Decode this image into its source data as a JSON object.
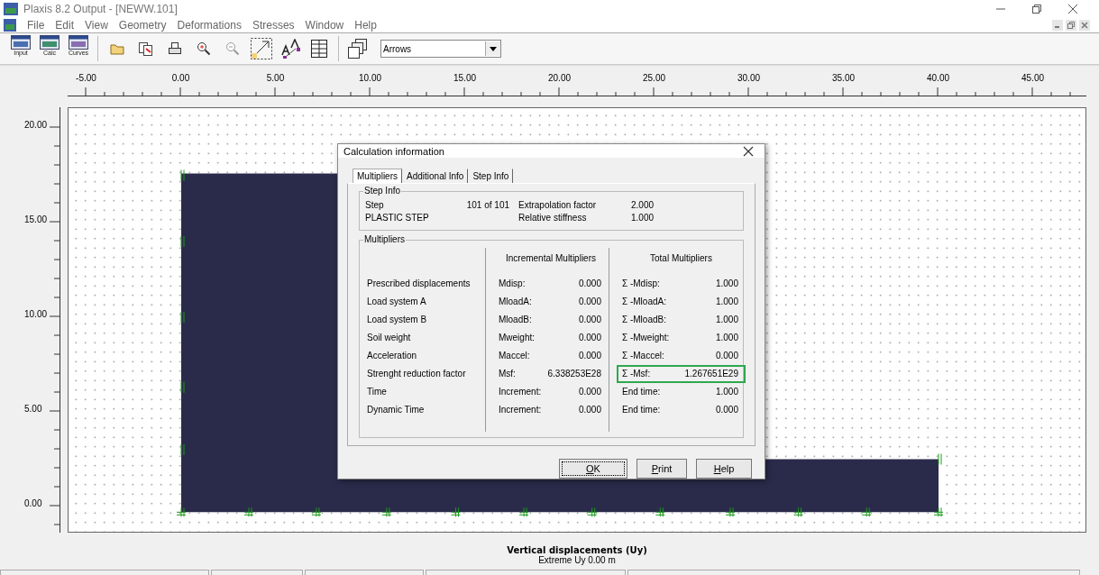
{
  "window": {
    "title": "Plaxis 8.2 Output - [NEWW.101]"
  },
  "menu": [
    "File",
    "Edit",
    "View",
    "Geometry",
    "Deformations",
    "Stresses",
    "Window",
    "Help"
  ],
  "toolbar": {
    "program_buttons": [
      {
        "label": "Input"
      },
      {
        "label": "Calc"
      },
      {
        "label": "Curves"
      }
    ],
    "dropdown": {
      "value": "Arrows"
    }
  },
  "plot": {
    "x_ticks": [
      "-5.00",
      "0.00",
      "5.00",
      "10.00",
      "15.00",
      "20.00",
      "25.00",
      "30.00",
      "35.00",
      "40.00",
      "45.00"
    ],
    "y_ticks": [
      "20.00",
      "15.00",
      "10.00",
      "5.00",
      "0.00"
    ],
    "title": "Vertical displacements (Uy)",
    "subtitle": "Extreme Uy 0.00 m"
  },
  "dialog": {
    "title": "Calculation information",
    "tabs": [
      {
        "label": "Multipliers",
        "selected": true
      },
      {
        "label": "Additional Info",
        "selected": false
      },
      {
        "label": "Step Info",
        "selected": false
      }
    ],
    "step_info": {
      "title": "Step Info",
      "rows": [
        {
          "label": "Step",
          "value": "101 of 101",
          "param": "Extrapolation factor",
          "param_value": "2.000"
        },
        {
          "label": "PLASTIC STEP",
          "param": "Relative stiffness",
          "param_value": "1.000"
        }
      ]
    },
    "multipliers": {
      "title": "Multipliers",
      "incremental_header": "Incremental Multipliers",
      "total_header": "Total Multipliers",
      "rows": [
        {
          "label": "Prescribed displacements",
          "inc_name": "Mdisp:",
          "inc_value": "0.000",
          "total_name": "Σ -Mdisp:",
          "total_value": "1.000",
          "highlighted": false
        },
        {
          "label": "Load system A",
          "inc_name": "MloadA:",
          "inc_value": "0.000",
          "total_name": "Σ -MloadA:",
          "total_value": "1.000",
          "highlighted": false
        },
        {
          "label": "Load system B",
          "inc_name": "MloadB:",
          "inc_value": "0.000",
          "total_name": "Σ -MloadB:",
          "total_value": "1.000",
          "highlighted": false
        },
        {
          "label": "Soil weight",
          "inc_name": "Mweight:",
          "inc_value": "0.000",
          "total_name": "Σ -Mweight:",
          "total_value": "1.000",
          "highlighted": false
        },
        {
          "label": "Acceleration",
          "inc_name": "Maccel:",
          "inc_value": "0.000",
          "total_name": "Σ -Maccel:",
          "total_value": "0.000",
          "highlighted": false
        },
        {
          "label": "Strenght reduction factor",
          "inc_name": "Msf:",
          "inc_value": "6.338253E28",
          "total_name": "Σ -Msf:",
          "total_value": "1.267651E29",
          "highlighted": true
        },
        {
          "label": "Time",
          "inc_name": "Increment:",
          "inc_value": "0.000",
          "total_name": "End time:",
          "total_value": "1.000",
          "highlighted": false
        },
        {
          "label": "Dynamic Time",
          "inc_name": "Increment:",
          "inc_value": "0.000",
          "total_name": "End time:",
          "total_value": "0.000",
          "highlighted": false
        }
      ]
    },
    "buttons": [
      {
        "label": "OK",
        "focused": true
      },
      {
        "label": "Print",
        "focused": false
      },
      {
        "label": "Help",
        "focused": false
      }
    ]
  }
}
